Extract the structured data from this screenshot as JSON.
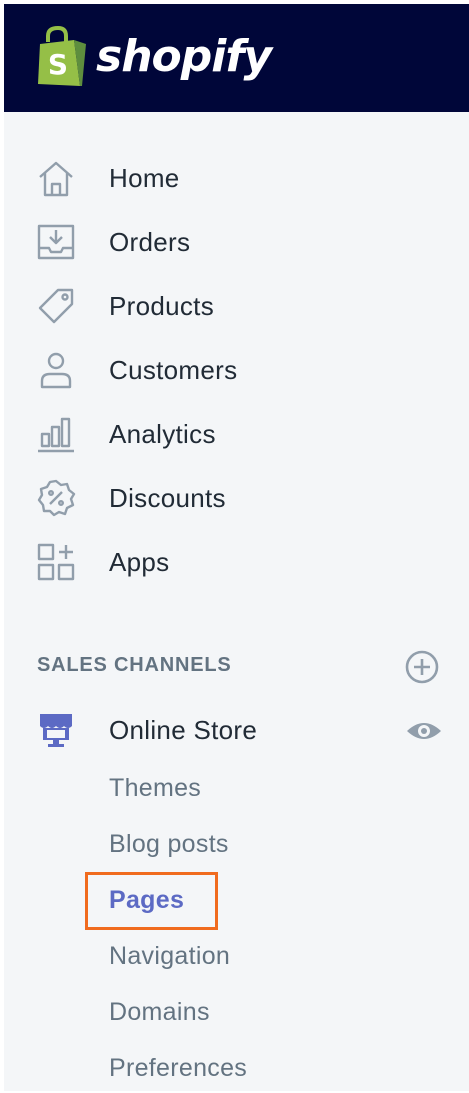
{
  "app": {
    "brand": "shopify",
    "brand_color": "#95bf47",
    "topbar_color": "#000639",
    "accent_color": "#5c6ac4",
    "highlight_color": "#f06b1f"
  },
  "nav": {
    "items": [
      {
        "label": "Home",
        "icon": "home-icon"
      },
      {
        "label": "Orders",
        "icon": "orders-icon"
      },
      {
        "label": "Products",
        "icon": "tag-icon"
      },
      {
        "label": "Customers",
        "icon": "person-icon"
      },
      {
        "label": "Analytics",
        "icon": "bar-chart-icon"
      },
      {
        "label": "Discounts",
        "icon": "discount-badge-icon"
      },
      {
        "label": "Apps",
        "icon": "apps-grid-icon"
      }
    ]
  },
  "sales_channels": {
    "title": "SALES CHANNELS",
    "add_icon": "plus-circle-icon",
    "online_store": {
      "label": "Online Store",
      "icon": "storefront-icon",
      "view_icon": "eye-icon",
      "subitems": [
        {
          "label": "Themes",
          "active": false
        },
        {
          "label": "Blog posts",
          "active": false
        },
        {
          "label": "Pages",
          "active": true
        },
        {
          "label": "Navigation",
          "active": false
        },
        {
          "label": "Domains",
          "active": false
        },
        {
          "label": "Preferences",
          "active": false
        }
      ]
    }
  }
}
